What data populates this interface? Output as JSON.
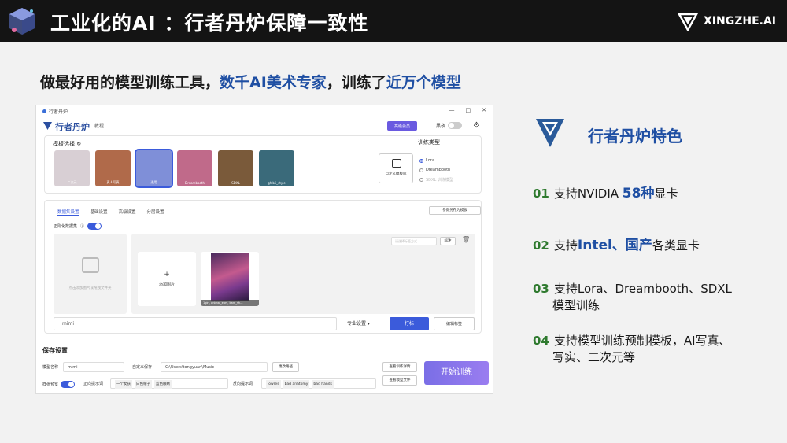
{
  "header": {
    "title": "工业化的AI ：行者丹炉保障一致性",
    "brand": "XINGZHE.AI"
  },
  "subtitle": {
    "part1": "做最好用的模型训练工具，",
    "part2": "数千AI美术专家",
    "part3": "，训练了",
    "part4": "近万个模型"
  },
  "window": {
    "titlebar": "行者丹炉",
    "controls": [
      "—",
      "□",
      "✕"
    ],
    "app_name": "行者丹炉",
    "tutorial": "教程",
    "vip": "高级会员",
    "theme_label": "黑夜",
    "template_section": {
      "title": "模板选择",
      "templates": [
        {
          "label": "二次元",
          "color": "#d8cfd4"
        },
        {
          "label": "真人写真",
          "color": "#b06a4a"
        },
        {
          "label": "通用",
          "color": "#7f8fd8"
        },
        {
          "label": "Dreambooth",
          "color": "#c06a8a"
        },
        {
          "label": "SDXL",
          "color": "#7a5a3a"
        },
        {
          "label": "ghibli_style",
          "color": "#3a6a7a"
        }
      ],
      "custom_template": "自定义模板库",
      "train_type_title": "训练类型",
      "train_types": [
        {
          "label": "Lora",
          "selected": true,
          "disabled": false
        },
        {
          "label": "Dreambooth",
          "selected": false,
          "disabled": false
        },
        {
          "label": "SDXL 训练模型",
          "selected": false,
          "disabled": true
        }
      ]
    },
    "dataset_section": {
      "tabs": [
        "数据集设置",
        "基础设置",
        "高级设置",
        "分层设置"
      ],
      "save_param": "参数另存为模板",
      "regularize_label": "正则化数据集",
      "drop_hint": "点击添加图片或拖拽文件夹",
      "tag_select_placeholder": "请选择标签方式",
      "tag_button": "标注",
      "add_image": "添加图片",
      "thumb_caption": "1girl, animal_ears, bare_sh...",
      "trigger_value": "mimi",
      "pro_settings": "专业设置",
      "tag_action": "打标",
      "edit_tags": "编辑标签"
    },
    "save_section": {
      "title": "保存设置",
      "model_name_label": "模型名称",
      "model_name_value": "mimi",
      "custom_save_label": "自定义保存",
      "custom_save_path": "C:\\Users\\tongyuan\\Music",
      "change_path": "更改路径",
      "sample_preview": "样张预览",
      "positive_prompt_label": "正向提示词",
      "positive_chips": [
        "一个女孩",
        "白色帽子",
        "蓝色眼睛"
      ],
      "negative_prompt_label": "反向提示词",
      "negative_chips": [
        "lowres",
        "bad anatomy",
        "bad hands"
      ],
      "view_detail": "查看训练详情",
      "view_model": "查看模型文件",
      "start_train": "开始训练"
    }
  },
  "features": {
    "title": "行者丹炉特色",
    "items": [
      {
        "num": "01",
        "pre": "支持NVIDIA ",
        "bold": "58种",
        "post": "显卡",
        "line2": ""
      },
      {
        "num": "02",
        "pre": "支持",
        "bold": "Intel、国产",
        "post": "各类显卡",
        "line2": ""
      },
      {
        "num": "03",
        "pre": "支持Lora、Dreambooth、SDXL",
        "bold": "",
        "post": "",
        "line2": "模型训练"
      },
      {
        "num": "04",
        "pre": "支持模型训练预制模板，AI写真、",
        "bold": "",
        "post": "",
        "line2": "写实、二次元等"
      }
    ]
  },
  "colors": {
    "accent_blue": "#1f4fa3",
    "number_green": "#2f7a2f",
    "primary_button": "#3b5bdb"
  }
}
